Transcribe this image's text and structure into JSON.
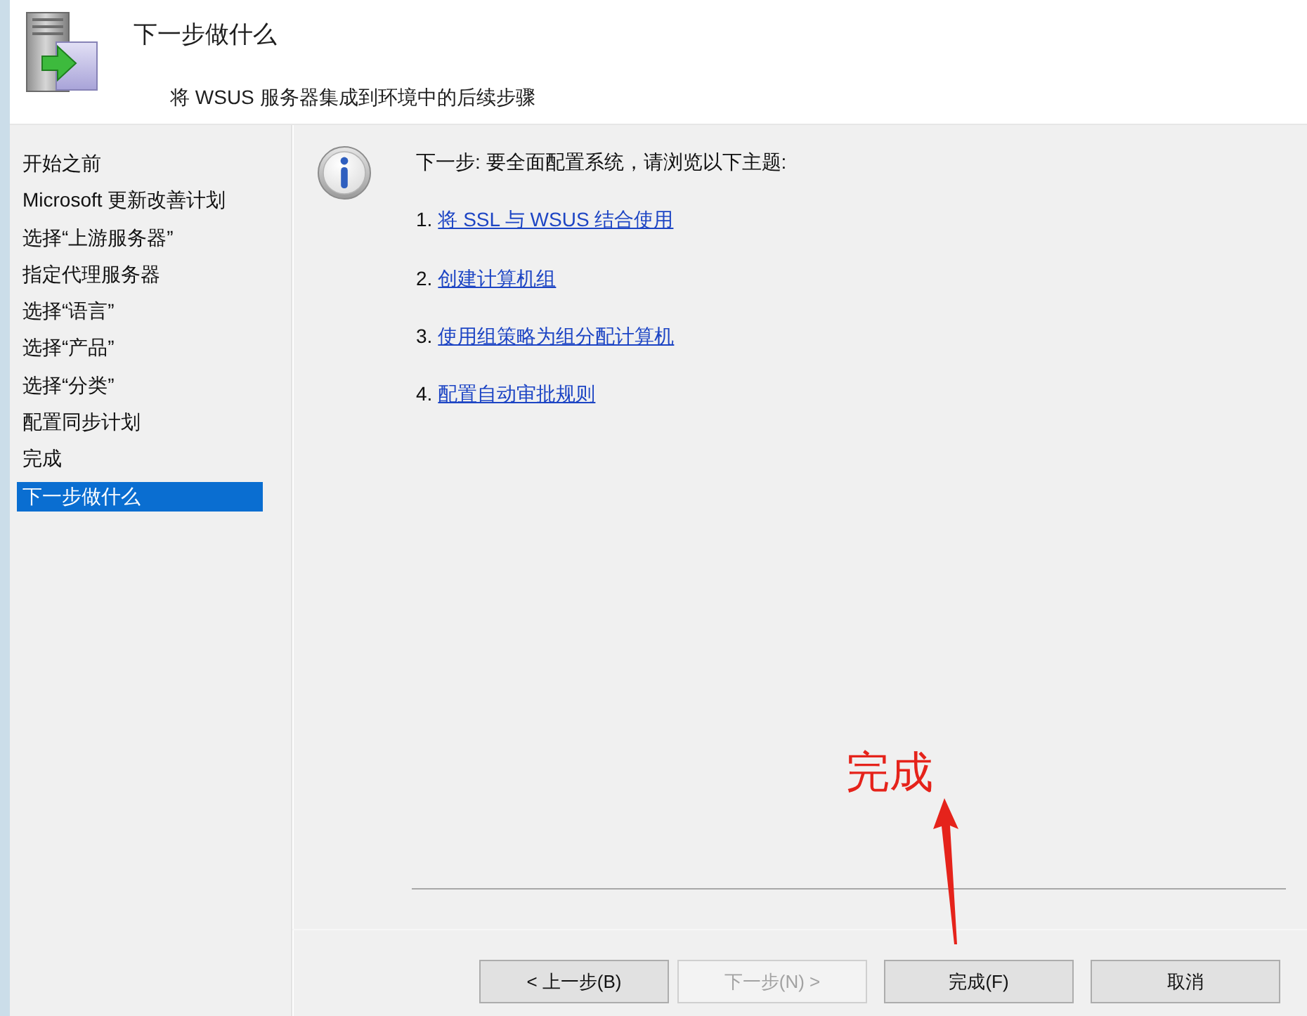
{
  "header": {
    "title": "下一步做什么",
    "subtitle": "将 WSUS 服务器集成到环境中的后续步骤"
  },
  "steps": [
    {
      "label": "开始之前",
      "selected": false
    },
    {
      "label": "Microsoft 更新改善计划",
      "selected": false
    },
    {
      "label": "选择“上游服务器”",
      "selected": false
    },
    {
      "label": "指定代理服务器",
      "selected": false
    },
    {
      "label": "选择“语言”",
      "selected": false
    },
    {
      "label": "选择“产品”",
      "selected": false
    },
    {
      "label": "选择“分类”",
      "selected": false
    },
    {
      "label": "配置同步计划",
      "selected": false
    },
    {
      "label": "完成",
      "selected": false
    },
    {
      "label": "下一步做什么",
      "selected": true
    }
  ],
  "content": {
    "intro": "下一步: 要全面配置系统，请浏览以下主题:",
    "topics": [
      {
        "number": "1.",
        "link": "将 SSL 与 WSUS 结合使用"
      },
      {
        "number": "2.",
        "link": "创建计算机组"
      },
      {
        "number": "3.",
        "link": "使用组策略为组分配计算机"
      },
      {
        "number": "4.",
        "link": "配置自动审批规则"
      }
    ]
  },
  "buttons": [
    {
      "label": "< 上一步(B)",
      "disabled": false
    },
    {
      "label": "下一步(N) >",
      "disabled": true
    },
    {
      "label": "完成(F)",
      "disabled": false
    },
    {
      "label": "取消",
      "disabled": false
    }
  ],
  "annotation": {
    "text": "完成"
  }
}
